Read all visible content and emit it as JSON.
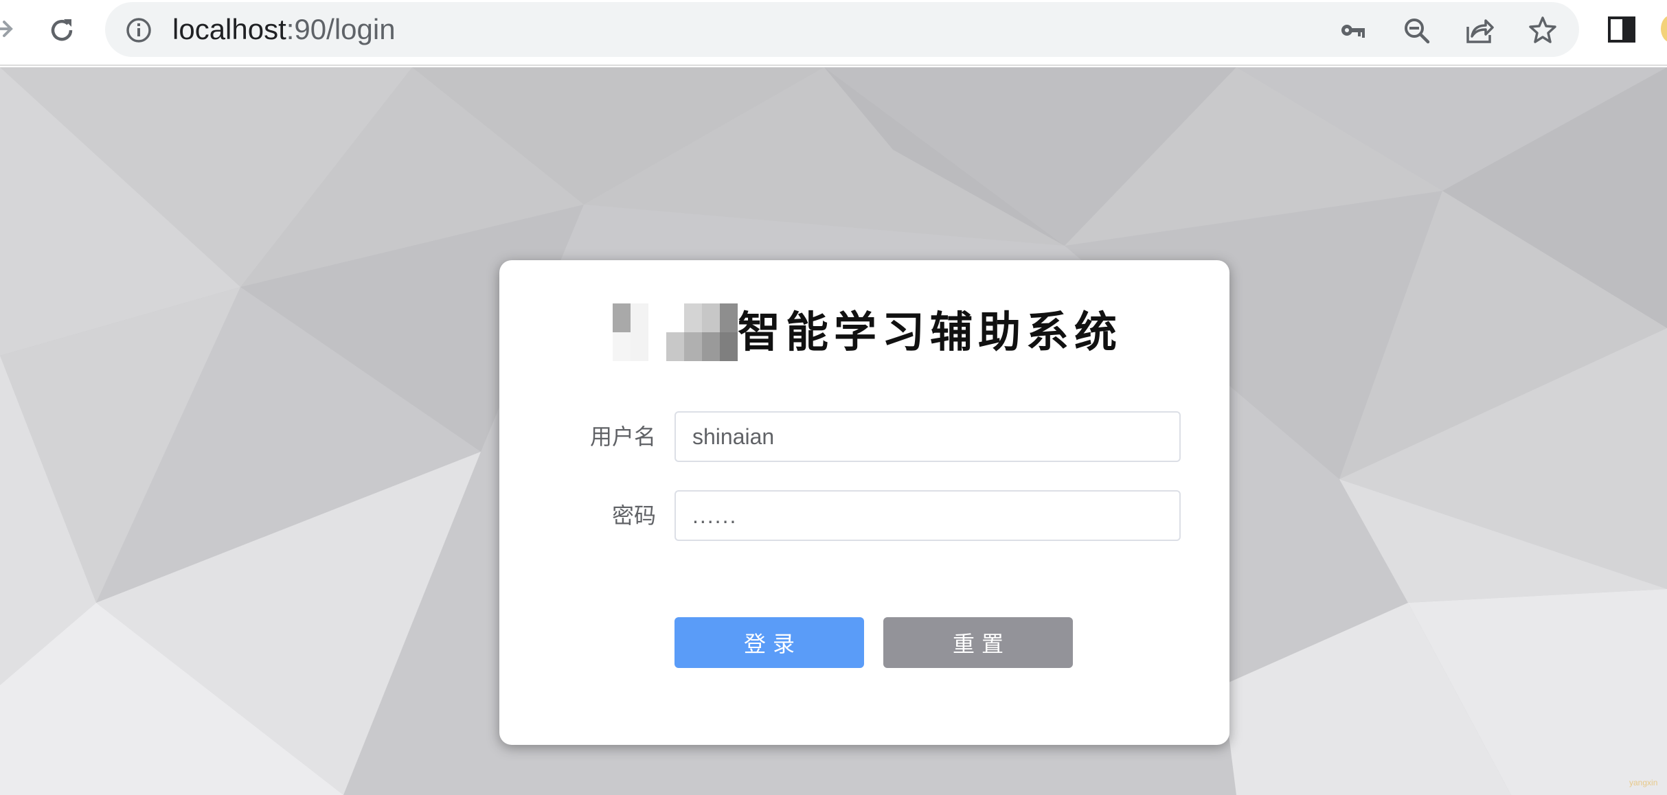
{
  "browser": {
    "url_host": "localhost",
    "url_path": ":90/login",
    "icons": {
      "forward": "arrow-right-icon",
      "reload": "reload-icon",
      "site_info": "info-circle-icon",
      "password": "key-icon",
      "zoom": "zoom-out-icon",
      "share": "share-icon",
      "bookmark": "star-icon",
      "side_panel": "side-panel-icon"
    }
  },
  "login": {
    "title": "智能学习辅助系统",
    "username_label": "用户名",
    "username_value": "shinaian",
    "password_label": "密码",
    "password_value": "......",
    "login_button": "登录",
    "reset_button": "重置"
  },
  "colors": {
    "primary_button": "#5a9cf8",
    "reset_button": "#939399",
    "background": "#c9c9cc"
  },
  "watermark": "yangxin"
}
